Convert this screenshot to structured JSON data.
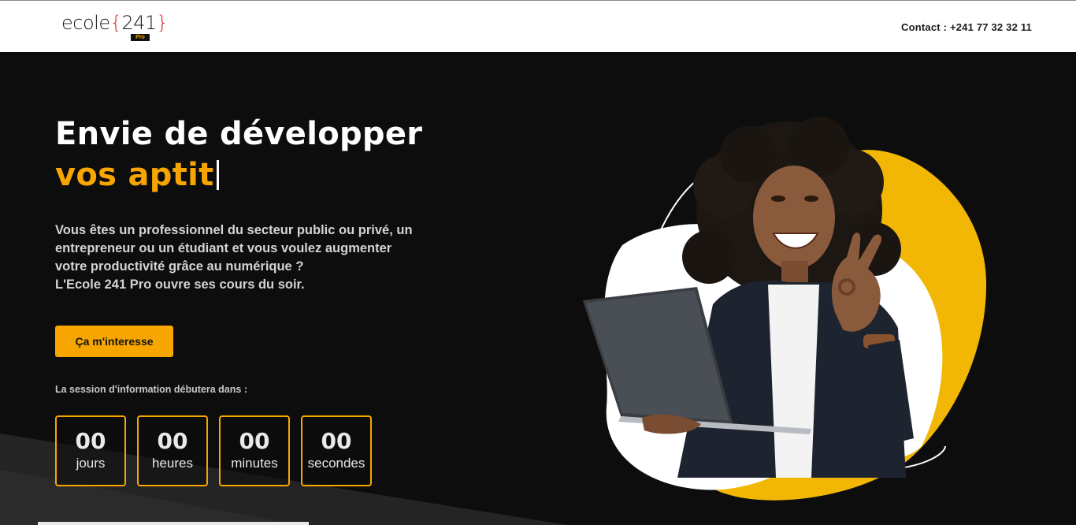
{
  "header": {
    "logo": {
      "word": "ecole",
      "brace_open": "{",
      "number": "241",
      "brace_close": "}",
      "badge": "Pro"
    },
    "contact": "Contact : +241 77 32 32 11"
  },
  "hero": {
    "headline_line1": "Envie de développer",
    "headline_line2": "vos aptit",
    "intro_lines": [
      "Vous êtes un professionnel du secteur public ou privé, un",
      "entrepreneur ou un étudiant et vous voulez augmenter",
      "votre productivité grâce au numérique ?",
      "L'Ecole 241 Pro ouvre ses cours du soir."
    ],
    "cta_label": "Ça m'interesse",
    "session_label": "La session d'information débutera dans :",
    "countdown": [
      {
        "value": "00",
        "unit": "jours"
      },
      {
        "value": "00",
        "unit": "heures"
      },
      {
        "value": "00",
        "unit": "minutes"
      },
      {
        "value": "00",
        "unit": "secondes"
      }
    ]
  },
  "colors": {
    "accent": "#f7a500",
    "hero_bg": "#0d0d0d",
    "logo_brace": "#d7262b",
    "blob_yellow": "#f2b705"
  },
  "icons": {
    "photo": "woman-with-laptop-photo"
  }
}
